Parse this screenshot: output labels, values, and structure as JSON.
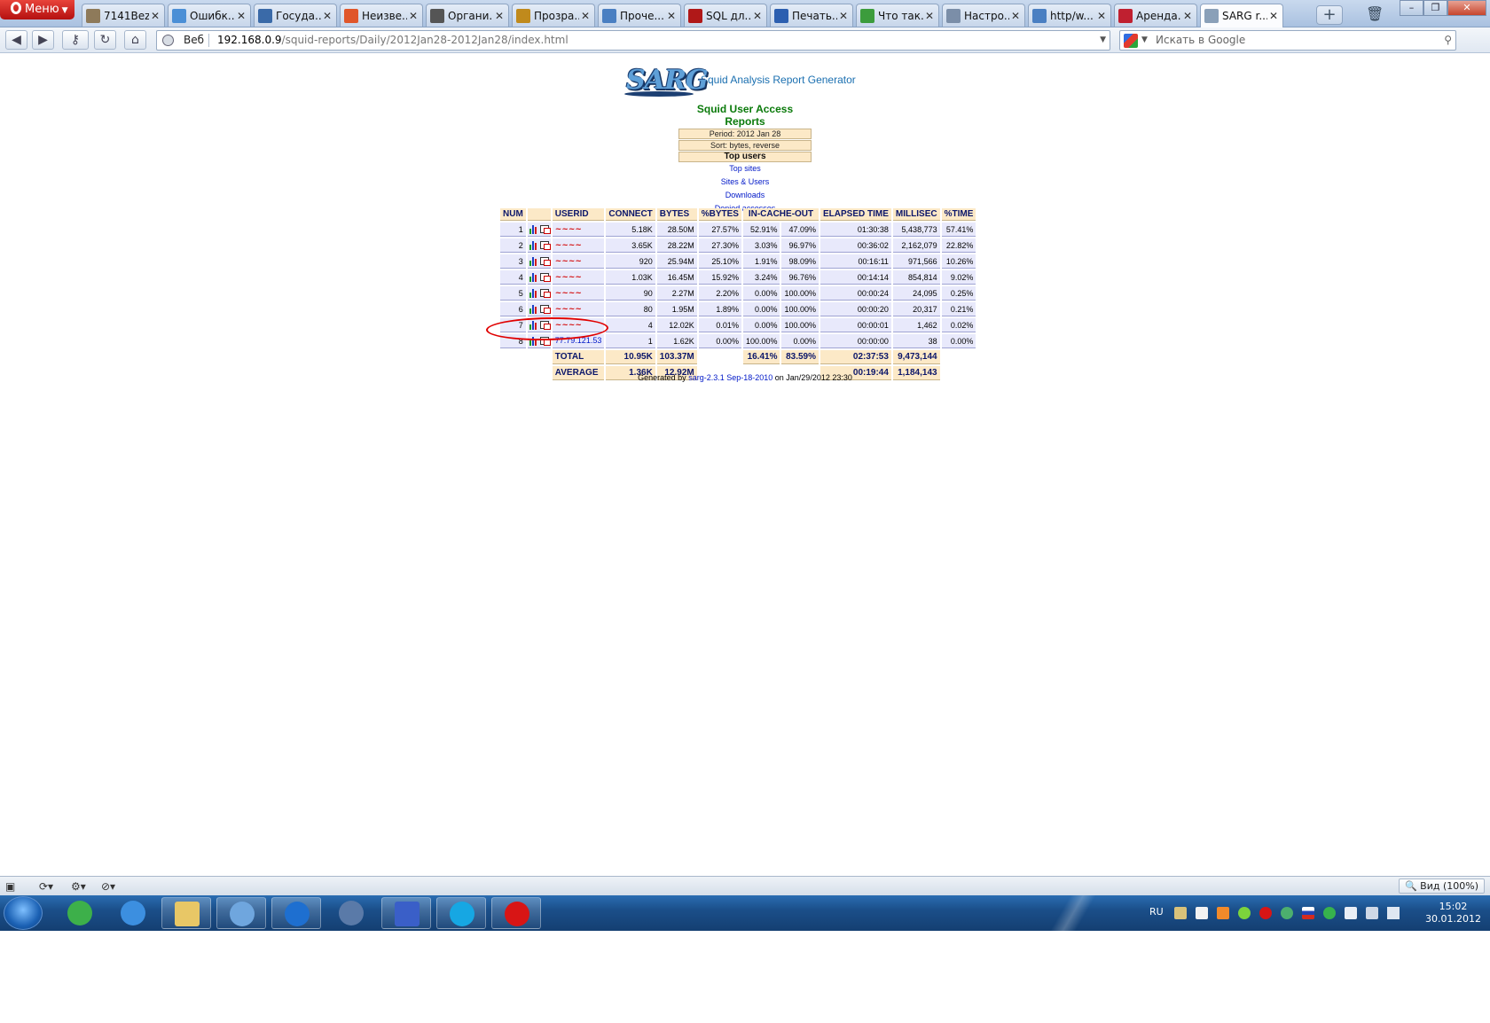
{
  "browser": {
    "menu_label": "Меню",
    "tabs": [
      {
        "title": "7141Bez...",
        "color": "#8e7a5a"
      },
      {
        "title": "Ошибк...",
        "color": "#4b8fd6"
      },
      {
        "title": "Госуда...",
        "color": "#3a6aa8"
      },
      {
        "title": "Неизве...",
        "color": "#e0562a"
      },
      {
        "title": "Органи...",
        "color": "#555555"
      },
      {
        "title": "Прозра...",
        "color": "#c08a1c"
      },
      {
        "title": "Проче...",
        "color": "#4a7fc2"
      },
      {
        "title": "SQL дл...",
        "color": "#b01818"
      },
      {
        "title": "Печать...",
        "color": "#2c5fb0"
      },
      {
        "title": "Что так...",
        "color": "#3c9c3c"
      },
      {
        "title": "Настро...",
        "color": "#7b8ea8"
      },
      {
        "title": "http/w...",
        "color": "#4a7fc2"
      },
      {
        "title": "Аренда...",
        "color": "#c02030"
      },
      {
        "title": "SARG r...",
        "color": "#8aa0b8"
      }
    ],
    "address_label": "Веб",
    "url_host": "192.168.0.9",
    "url_path": "/squid-reports/Daily/2012Jan28-2012Jan28/index.html",
    "search_placeholder": "Искать в Google",
    "zoom_label": "Вид (100%)"
  },
  "report": {
    "logo_text": "SARG",
    "subtitle": "Squid Analysis Report Generator",
    "heading": "Squid User Access Reports",
    "period": "Period: 2012 Jan 28",
    "sort": "Sort: bytes, reverse",
    "section": "Top users",
    "links": [
      "Top sites",
      "Sites & Users",
      "Downloads",
      "Denied accesses"
    ],
    "columns": [
      "NUM",
      "",
      "USERID",
      "CONNECT",
      "BYTES",
      "%BYTES",
      "IN-CACHE-OUT",
      "",
      "ELAPSED TIME",
      "MILLISEC",
      "%TIME"
    ],
    "rows": [
      {
        "num": "1",
        "userid": "~~~~",
        "connect": "5.18K",
        "bytes": "28.50M",
        "pbytes": "27.57%",
        "in": "52.91%",
        "out": "47.09%",
        "elapsed": "01:30:38",
        "ms": "5,438,773",
        "ptime": "57.41%"
      },
      {
        "num": "2",
        "userid": "~~~~",
        "connect": "3.65K",
        "bytes": "28.22M",
        "pbytes": "27.30%",
        "in": "3.03%",
        "out": "96.97%",
        "elapsed": "00:36:02",
        "ms": "2,162,079",
        "ptime": "22.82%"
      },
      {
        "num": "3",
        "userid": "~~~~",
        "connect": "920",
        "bytes": "25.94M",
        "pbytes": "25.10%",
        "in": "1.91%",
        "out": "98.09%",
        "elapsed": "00:16:11",
        "ms": "971,566",
        "ptime": "10.26%"
      },
      {
        "num": "4",
        "userid": "~~~~",
        "connect": "1.03K",
        "bytes": "16.45M",
        "pbytes": "15.92%",
        "in": "3.24%",
        "out": "96.76%",
        "elapsed": "00:14:14",
        "ms": "854,814",
        "ptime": "9.02%"
      },
      {
        "num": "5",
        "userid": "~~~~",
        "connect": "90",
        "bytes": "2.27M",
        "pbytes": "2.20%",
        "in": "0.00%",
        "out": "100.00%",
        "elapsed": "00:00:24",
        "ms": "24,095",
        "ptime": "0.25%"
      },
      {
        "num": "6",
        "userid": "~~~~",
        "connect": "80",
        "bytes": "1.95M",
        "pbytes": "1.89%",
        "in": "0.00%",
        "out": "100.00%",
        "elapsed": "00:00:20",
        "ms": "20,317",
        "ptime": "0.21%"
      },
      {
        "num": "7",
        "userid": "~~~~",
        "connect": "4",
        "bytes": "12.02K",
        "pbytes": "0.01%",
        "in": "0.00%",
        "out": "100.00%",
        "elapsed": "00:00:01",
        "ms": "1,462",
        "ptime": "0.02%"
      },
      {
        "num": "8",
        "userid": "77.79.121.53",
        "connect": "1",
        "bytes": "1.62K",
        "pbytes": "0.00%",
        "in": "100.00%",
        "out": "0.00%",
        "elapsed": "00:00:00",
        "ms": "38",
        "ptime": "0.00%"
      }
    ],
    "total": {
      "label": "TOTAL",
      "connect": "10.95K",
      "bytes": "103.37M",
      "in": "16.41%",
      "out": "83.59%",
      "elapsed": "02:37:53",
      "ms": "9,473,144"
    },
    "average": {
      "label": "AVERAGE",
      "connect": "1.36K",
      "bytes": "12.92M",
      "elapsed": "00:19:44",
      "ms": "1,184,143"
    },
    "generated_prefix": "Generated by",
    "generated_link": "sarg-2.3.1 Sep-18-2010",
    "generated_suffix": "on Jan/29/2012 23:30"
  },
  "taskbar": {
    "lang": "RU",
    "time": "15:02",
    "date": "30.01.2012"
  }
}
